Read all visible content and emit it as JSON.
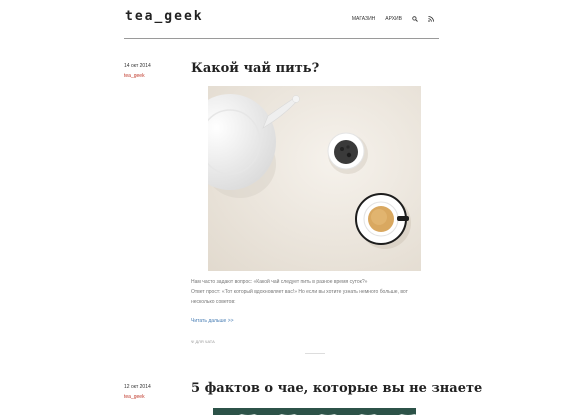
{
  "site": {
    "logo": "tea_geek"
  },
  "nav": {
    "items": [
      {
        "label": "МАГАЗИН"
      },
      {
        "label": "АРХИВ"
      }
    ],
    "icons": [
      "search-icon",
      "rss-icon"
    ]
  },
  "posts": [
    {
      "date": "14 окт 2014",
      "tag": "tea_geek",
      "title": "Какой чай пить?",
      "excerpt_lines": [
        "Нам часто задают вопрос: «Какой чай следует пить в разное время суток?»",
        "Ответ прост: «Тот который вдохновляет вас!» Но если вы хотите узнать немного больше, вот",
        "несколько советов:"
      ],
      "read_more": "Читать дальше >>",
      "share_label": "Ψ  ДЛЯ ЧАТА"
    },
    {
      "date": "12 окт 2014",
      "tag": "tea_geek",
      "title": "5 фактов о чае, которые вы не знаете"
    }
  ],
  "colors": {
    "tag": "#c0392b",
    "link": "#4a7fb5",
    "rule": "#9a9a9a",
    "photo2": "#2c5248"
  }
}
